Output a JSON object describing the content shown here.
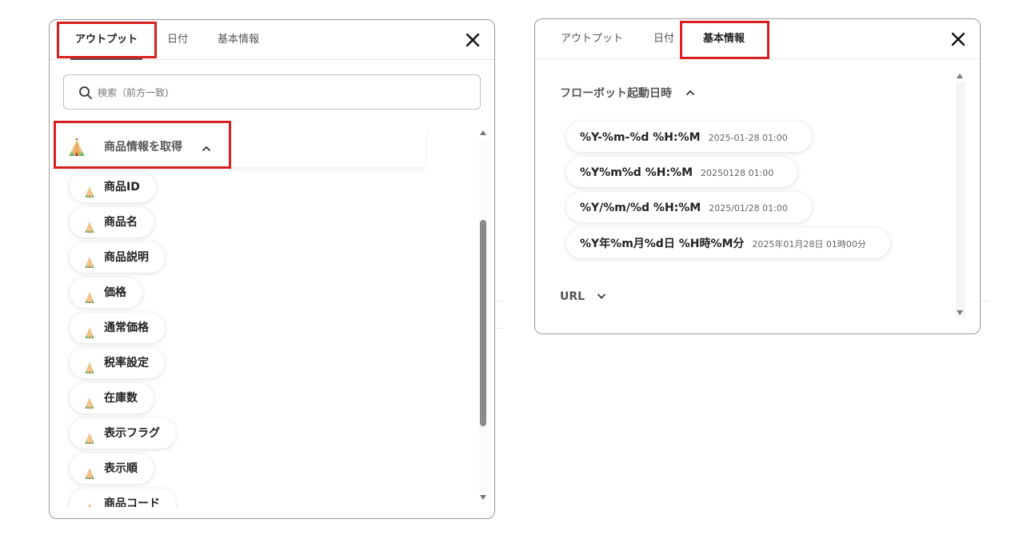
{
  "left_panel": {
    "tabs": [
      {
        "label": "アウトプット",
        "active": true
      },
      {
        "label": "日付",
        "active": false
      },
      {
        "label": "基本情報",
        "active": false
      }
    ],
    "search": {
      "placeholder": "検索（前方一致)",
      "value": ""
    },
    "group": {
      "label": "商品情報を取得",
      "expanded": true,
      "icon": "tipi-icon"
    },
    "items": [
      "商品ID",
      "商品名",
      "商品説明",
      "価格",
      "通常価格",
      "税率設定",
      "在庫数",
      "表示フラグ",
      "表示順",
      "商品コード"
    ]
  },
  "right_panel": {
    "tabs": [
      {
        "label": "アウトプット",
        "active": false
      },
      {
        "label": "日付",
        "active": false
      },
      {
        "label": "基本情報",
        "active": true
      }
    ],
    "section1": {
      "label": "フローボット起動日時",
      "expanded": true
    },
    "formats": [
      {
        "code": "%Y-%m-%d %H:%M",
        "example": "2025-01-28 01:00"
      },
      {
        "code": "%Y%m%d %H:%M",
        "example": "20250128 01:00"
      },
      {
        "code": "%Y/%m/%d %H:%M",
        "example": "2025/01/28 01:00"
      },
      {
        "code": "%Y年%m月%d日 %H時%M分",
        "example": "2025年01月28日 01時00分"
      }
    ],
    "section2": {
      "label": "URL",
      "expanded": false
    }
  },
  "colors": {
    "highlight": "#d81e1e",
    "border": "#9a9a9a",
    "scroll_thumb": "#8a8a8a"
  }
}
